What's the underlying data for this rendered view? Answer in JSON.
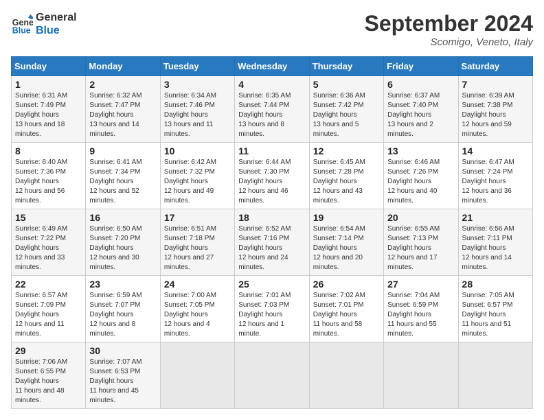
{
  "header": {
    "logo_line1": "General",
    "logo_line2": "Blue",
    "month": "September 2024",
    "location": "Scomigo, Veneto, Italy"
  },
  "weekdays": [
    "Sunday",
    "Monday",
    "Tuesday",
    "Wednesday",
    "Thursday",
    "Friday",
    "Saturday"
  ],
  "weeks": [
    [
      {
        "day": "1",
        "sunrise": "6:31 AM",
        "sunset": "7:49 PM",
        "daylight": "13 hours and 18 minutes."
      },
      {
        "day": "2",
        "sunrise": "6:32 AM",
        "sunset": "7:47 PM",
        "daylight": "13 hours and 14 minutes."
      },
      {
        "day": "3",
        "sunrise": "6:34 AM",
        "sunset": "7:46 PM",
        "daylight": "13 hours and 11 minutes."
      },
      {
        "day": "4",
        "sunrise": "6:35 AM",
        "sunset": "7:44 PM",
        "daylight": "13 hours and 8 minutes."
      },
      {
        "day": "5",
        "sunrise": "6:36 AM",
        "sunset": "7:42 PM",
        "daylight": "13 hours and 5 minutes."
      },
      {
        "day": "6",
        "sunrise": "6:37 AM",
        "sunset": "7:40 PM",
        "daylight": "13 hours and 2 minutes."
      },
      {
        "day": "7",
        "sunrise": "6:39 AM",
        "sunset": "7:38 PM",
        "daylight": "12 hours and 59 minutes."
      }
    ],
    [
      {
        "day": "8",
        "sunrise": "6:40 AM",
        "sunset": "7:36 PM",
        "daylight": "12 hours and 56 minutes."
      },
      {
        "day": "9",
        "sunrise": "6:41 AM",
        "sunset": "7:34 PM",
        "daylight": "12 hours and 52 minutes."
      },
      {
        "day": "10",
        "sunrise": "6:42 AM",
        "sunset": "7:32 PM",
        "daylight": "12 hours and 49 minutes."
      },
      {
        "day": "11",
        "sunrise": "6:44 AM",
        "sunset": "7:30 PM",
        "daylight": "12 hours and 46 minutes."
      },
      {
        "day": "12",
        "sunrise": "6:45 AM",
        "sunset": "7:28 PM",
        "daylight": "12 hours and 43 minutes."
      },
      {
        "day": "13",
        "sunrise": "6:46 AM",
        "sunset": "7:26 PM",
        "daylight": "12 hours and 40 minutes."
      },
      {
        "day": "14",
        "sunrise": "6:47 AM",
        "sunset": "7:24 PM",
        "daylight": "12 hours and 36 minutes."
      }
    ],
    [
      {
        "day": "15",
        "sunrise": "6:49 AM",
        "sunset": "7:22 PM",
        "daylight": "12 hours and 33 minutes."
      },
      {
        "day": "16",
        "sunrise": "6:50 AM",
        "sunset": "7:20 PM",
        "daylight": "12 hours and 30 minutes."
      },
      {
        "day": "17",
        "sunrise": "6:51 AM",
        "sunset": "7:18 PM",
        "daylight": "12 hours and 27 minutes."
      },
      {
        "day": "18",
        "sunrise": "6:52 AM",
        "sunset": "7:16 PM",
        "daylight": "12 hours and 24 minutes."
      },
      {
        "day": "19",
        "sunrise": "6:54 AM",
        "sunset": "7:14 PM",
        "daylight": "12 hours and 20 minutes."
      },
      {
        "day": "20",
        "sunrise": "6:55 AM",
        "sunset": "7:13 PM",
        "daylight": "12 hours and 17 minutes."
      },
      {
        "day": "21",
        "sunrise": "6:56 AM",
        "sunset": "7:11 PM",
        "daylight": "12 hours and 14 minutes."
      }
    ],
    [
      {
        "day": "22",
        "sunrise": "6:57 AM",
        "sunset": "7:09 PM",
        "daylight": "12 hours and 11 minutes."
      },
      {
        "day": "23",
        "sunrise": "6:59 AM",
        "sunset": "7:07 PM",
        "daylight": "12 hours and 8 minutes."
      },
      {
        "day": "24",
        "sunrise": "7:00 AM",
        "sunset": "7:05 PM",
        "daylight": "12 hours and 4 minutes."
      },
      {
        "day": "25",
        "sunrise": "7:01 AM",
        "sunset": "7:03 PM",
        "daylight": "12 hours and 1 minute."
      },
      {
        "day": "26",
        "sunrise": "7:02 AM",
        "sunset": "7:01 PM",
        "daylight": "11 hours and 58 minutes."
      },
      {
        "day": "27",
        "sunrise": "7:04 AM",
        "sunset": "6:59 PM",
        "daylight": "11 hours and 55 minutes."
      },
      {
        "day": "28",
        "sunrise": "7:05 AM",
        "sunset": "6:57 PM",
        "daylight": "11 hours and 51 minutes."
      }
    ],
    [
      {
        "day": "29",
        "sunrise": "7:06 AM",
        "sunset": "6:55 PM",
        "daylight": "11 hours and 48 minutes."
      },
      {
        "day": "30",
        "sunrise": "7:07 AM",
        "sunset": "6:53 PM",
        "daylight": "11 hours and 45 minutes."
      },
      null,
      null,
      null,
      null,
      null
    ]
  ]
}
